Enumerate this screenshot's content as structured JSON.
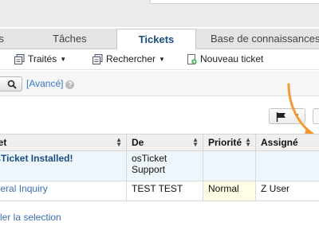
{
  "tabs": [
    {
      "label": "rs"
    },
    {
      "label": "Tâches"
    },
    {
      "label": "Tickets",
      "active": true
    },
    {
      "label": "Base de connaissances"
    }
  ],
  "subnav": {
    "traites": "Traités",
    "rechercher": "Rechercher",
    "nouveau": "Nouveau ticket"
  },
  "search": {
    "advanced_label": "[Avancé]",
    "help_glyph": "?"
  },
  "table": {
    "headers": [
      "ujet",
      "De",
      "Priorité",
      "Assigné"
    ],
    "rows": [
      {
        "subject": "osTicket Installed!",
        "from": "osTicket Support",
        "priority": "",
        "assignee": ""
      },
      {
        "subject": "eneral Inquiry",
        "from": "TEST TEST",
        "priority": "Normal",
        "assignee": "Z User"
      }
    ]
  },
  "footer": {
    "select_link": "ler la selection"
  },
  "colors": {
    "accent": "#184e81",
    "link": "#3a6fb5",
    "arrow": "#f39a32"
  },
  "icons": [
    "search-icon",
    "help-icon",
    "flag-icon",
    "ticket-icon",
    "new-ticket-icon",
    "sort-icon",
    "annotation-arrow"
  ]
}
